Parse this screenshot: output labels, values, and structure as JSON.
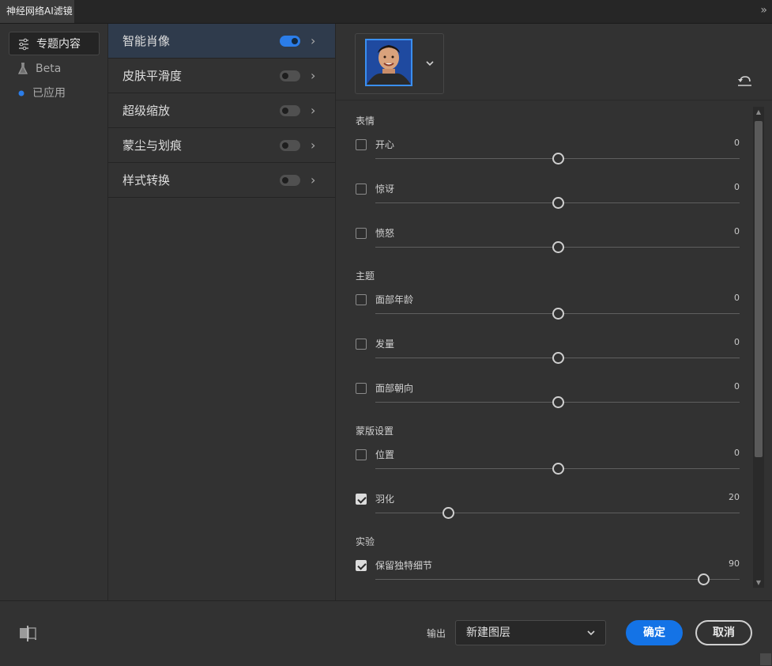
{
  "window": {
    "title": "神经网络AI滤镜"
  },
  "categories": [
    {
      "label": "专题内容",
      "icon": "sliders-icon",
      "active": true
    },
    {
      "label": "Beta",
      "icon": "flask-icon"
    },
    {
      "label": "已应用",
      "icon": "dot-icon"
    }
  ],
  "filters": [
    {
      "label": "智能肖像",
      "enabled": true,
      "selected": true
    },
    {
      "label": "皮肤平滑度",
      "enabled": false
    },
    {
      "label": "超级缩放",
      "enabled": false
    },
    {
      "label": "蒙尘与划痕",
      "enabled": false
    },
    {
      "label": "样式转换",
      "enabled": false
    }
  ],
  "sections": {
    "expression": "表情",
    "theme": "主题",
    "mask": "蒙版设置",
    "experimental": "实验"
  },
  "controls": {
    "happy": {
      "label": "开心",
      "value": "0",
      "checked": false,
      "position": 0.5
    },
    "surprise": {
      "label": "惊讶",
      "value": "0",
      "checked": false,
      "position": 0.5
    },
    "anger": {
      "label": "愤怒",
      "value": "0",
      "checked": false,
      "position": 0.5
    },
    "facial_age": {
      "label": "面部年龄",
      "value": "0",
      "checked": false,
      "position": 0.5
    },
    "hair": {
      "label": "发量",
      "value": "0",
      "checked": false,
      "position": 0.5
    },
    "head_direction": {
      "label": "面部朝向",
      "value": "0",
      "checked": false,
      "position": 0.5
    },
    "position": {
      "label": "位置",
      "value": "0",
      "checked": false,
      "position": 0.5
    },
    "feather": {
      "label": "羽化",
      "value": "20",
      "checked": true,
      "position": 0.2
    },
    "retain_details": {
      "label": "保留独特细节",
      "value": "90",
      "checked": true,
      "position": 0.9
    }
  },
  "footer": {
    "output_label": "输出",
    "output_value": "新建图层",
    "ok_label": "确定",
    "cancel_label": "取消"
  },
  "colors": {
    "accent": "#1473e6",
    "selected_row": "#2f3b4c"
  }
}
